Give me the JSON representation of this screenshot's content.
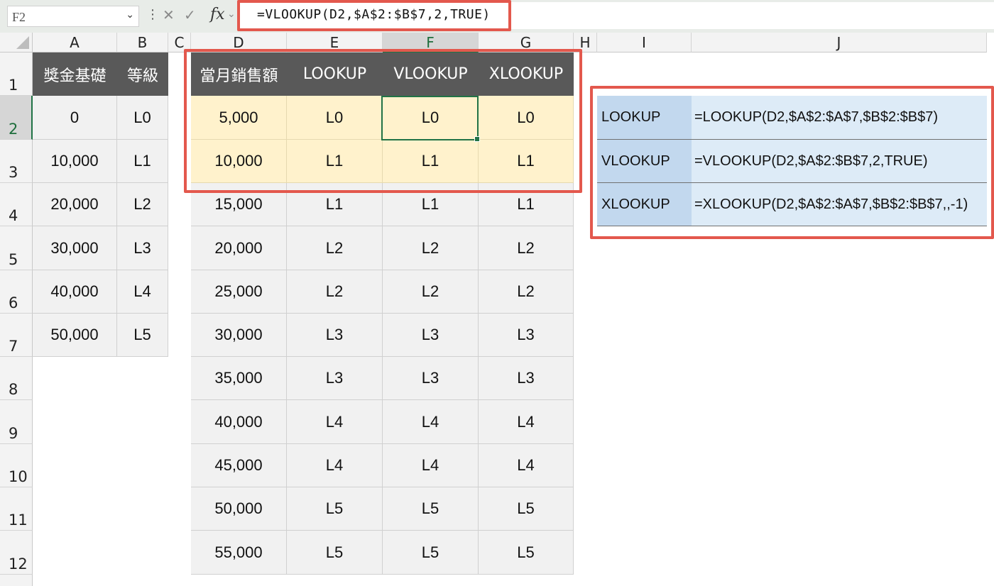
{
  "name_box": "F2",
  "formula": "=VLOOKUP(D2,$A$2:$B$7,2,TRUE)",
  "formula_bar_icons": [
    "more-dots-icon",
    "cancel-x-icon",
    "confirm-check-icon",
    "fx-icon",
    "chevron-down-icon"
  ],
  "fx_label": "fx",
  "columns": [
    "A",
    "B",
    "C",
    "D",
    "E",
    "F",
    "G",
    "H",
    "I",
    "J"
  ],
  "selected_column": "F",
  "rows": [
    "1",
    "2",
    "3",
    "4",
    "5",
    "6",
    "7",
    "8",
    "9",
    "10",
    "11",
    "12"
  ],
  "selected_row": "2",
  "lookup_table": {
    "headers": [
      "獎金基礎",
      "等級"
    ],
    "rows": [
      [
        "0",
        "L0"
      ],
      [
        "10,000",
        "L1"
      ],
      [
        "20,000",
        "L2"
      ],
      [
        "30,000",
        "L3"
      ],
      [
        "40,000",
        "L4"
      ],
      [
        "50,000",
        "L5"
      ]
    ]
  },
  "results_table": {
    "headers": [
      "當月銷售額",
      "LOOKUP",
      "VLOOKUP",
      "XLOOKUP"
    ],
    "rows": [
      [
        "5,000",
        "L0",
        "L0",
        "L0"
      ],
      [
        "10,000",
        "L1",
        "L1",
        "L1"
      ],
      [
        "15,000",
        "L1",
        "L1",
        "L1"
      ],
      [
        "20,000",
        "L2",
        "L2",
        "L2"
      ],
      [
        "25,000",
        "L2",
        "L2",
        "L2"
      ],
      [
        "30,000",
        "L3",
        "L3",
        "L3"
      ],
      [
        "35,000",
        "L3",
        "L3",
        "L3"
      ],
      [
        "40,000",
        "L4",
        "L4",
        "L4"
      ],
      [
        "45,000",
        "L4",
        "L4",
        "L4"
      ],
      [
        "50,000",
        "L5",
        "L5",
        "L5"
      ],
      [
        "55,000",
        "L5",
        "L5",
        "L5"
      ]
    ],
    "highlighted_rows": 2
  },
  "formula_table": {
    "rows": [
      [
        "LOOKUP",
        "=LOOKUP(D2,$A$2:$A$7,$B$2:$B$7)"
      ],
      [
        "VLOOKUP",
        "=VLOOKUP(D2,$A$2:$B$7,2,TRUE)"
      ],
      [
        "XLOOKUP",
        "=XLOOKUP(D2,$A$2:$A$7,$B$2:$B$7,,-1)"
      ]
    ]
  },
  "colors": {
    "header_fill": "#595959",
    "highlight_fill": "#fff2cc",
    "annotation_red": "#e3584d",
    "selection_green": "#217346",
    "label_blue": "#c2d8ee",
    "formula_blue": "#ddebf7"
  }
}
